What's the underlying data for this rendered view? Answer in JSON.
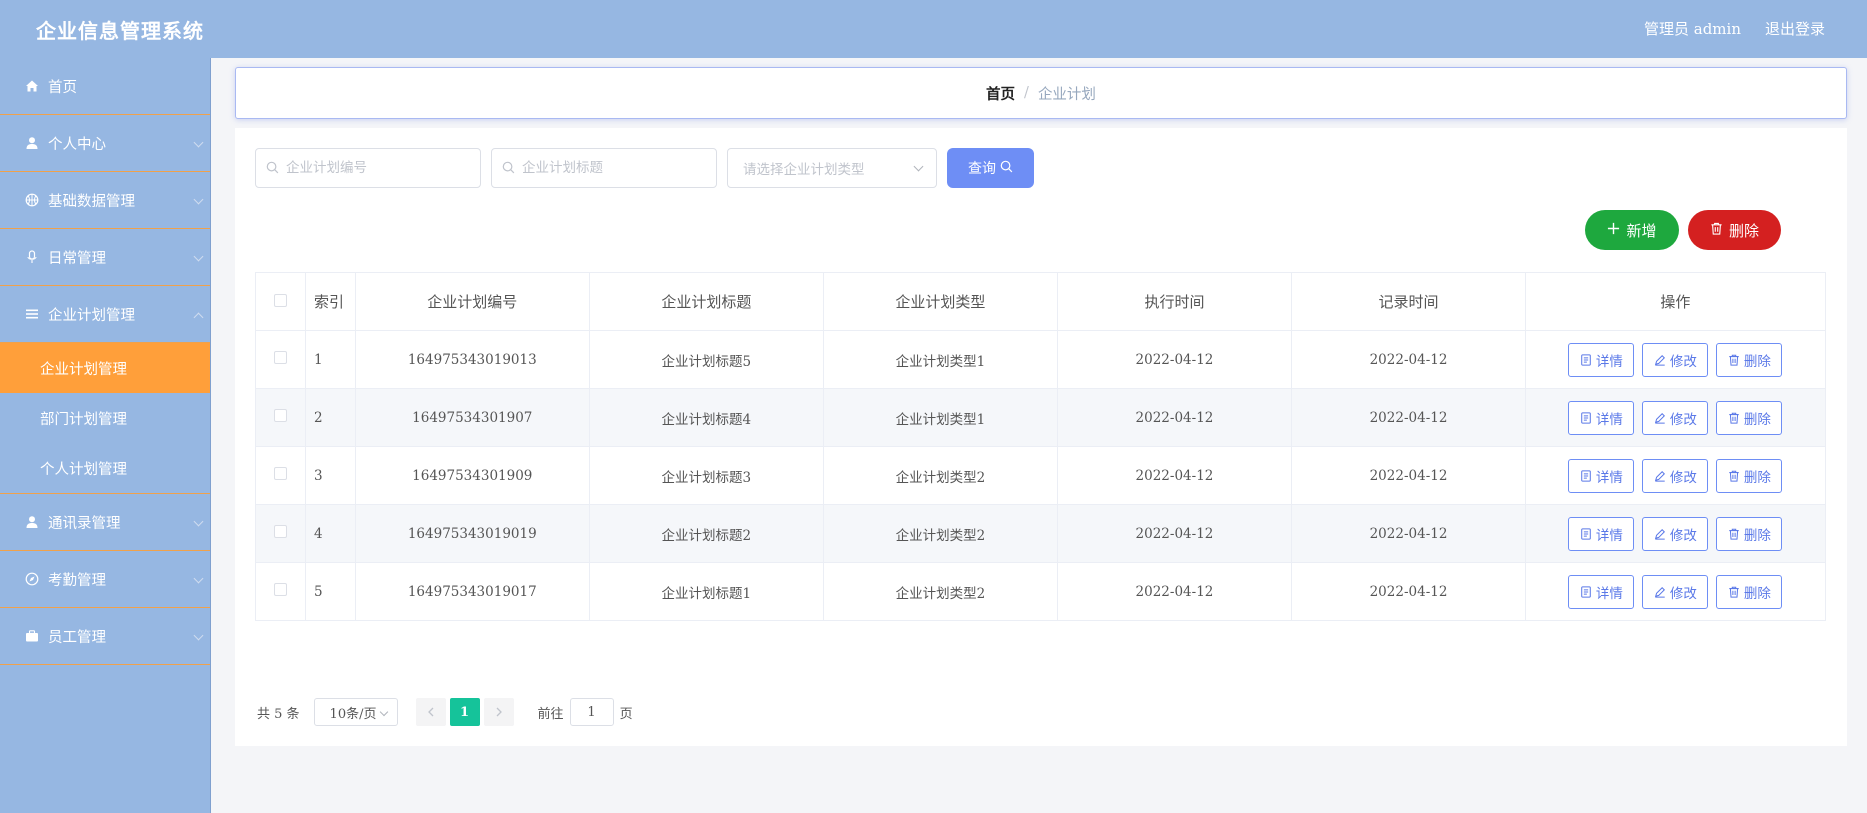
{
  "header": {
    "title": "企业信息管理系统",
    "user_label": "管理员 admin",
    "logout_label": "退出登录"
  },
  "sidebar": {
    "items": [
      {
        "label": "首页",
        "icon": "home-icon"
      },
      {
        "label": "个人中心",
        "icon": "user-icon"
      },
      {
        "label": "基础数据管理",
        "icon": "basketball-icon"
      },
      {
        "label": "日常管理",
        "icon": "microphone-icon"
      },
      {
        "label": "企业计划管理",
        "icon": "menu-icon",
        "children": [
          "企业计划管理",
          "部门计划管理",
          "个人计划管理"
        ],
        "active_child": "企业计划管理"
      },
      {
        "label": "通讯录管理",
        "icon": "user-icon"
      },
      {
        "label": "考勤管理",
        "icon": "compass-icon"
      },
      {
        "label": "员工管理",
        "icon": "briefcase-icon"
      }
    ]
  },
  "breadcrumb": {
    "home": "首页",
    "separator": "/",
    "current": "企业计划"
  },
  "search": {
    "code_placeholder": "企业计划编号",
    "title_placeholder": "企业计划标题",
    "type_placeholder": "请选择企业计划类型",
    "query_label": "查询"
  },
  "actions": {
    "add_label": "新增",
    "delete_label": "删除"
  },
  "table": {
    "headers": {
      "index": "索引",
      "code": "企业计划编号",
      "title": "企业计划标题",
      "type": "企业计划类型",
      "exec_time": "执行时间",
      "record_time": "记录时间",
      "ops": "操作"
    },
    "rows": [
      {
        "index": "1",
        "code": "164975343019013",
        "title": "企业计划标题5",
        "type": "企业计划类型1",
        "exec_time": "2022-04-12",
        "record_time": "2022-04-12"
      },
      {
        "index": "2",
        "code": "16497534301907",
        "title": "企业计划标题4",
        "type": "企业计划类型1",
        "exec_time": "2022-04-12",
        "record_time": "2022-04-12"
      },
      {
        "index": "3",
        "code": "16497534301909",
        "title": "企业计划标题3",
        "type": "企业计划类型2",
        "exec_time": "2022-04-12",
        "record_time": "2022-04-12"
      },
      {
        "index": "4",
        "code": "164975343019019",
        "title": "企业计划标题2",
        "type": "企业计划类型2",
        "exec_time": "2022-04-12",
        "record_time": "2022-04-12"
      },
      {
        "index": "5",
        "code": "164975343019017",
        "title": "企业计划标题1",
        "type": "企业计划类型2",
        "exec_time": "2022-04-12",
        "record_time": "2022-04-12"
      }
    ],
    "op_labels": {
      "detail": "详情",
      "edit": "修改",
      "delete": "删除"
    }
  },
  "pagination": {
    "total_label": "共 5 条",
    "page_size": "10条/页",
    "current_page": "1",
    "goto_label": "前往",
    "goto_value": "1",
    "page_unit": "页"
  },
  "colors": {
    "header_bg": "#96b7e2",
    "active_menu": "#ff9f3a",
    "query_btn": "#6e8ef5",
    "add_btn": "#1ea83e",
    "delete_btn": "#d42020",
    "page_active": "#15c39a"
  }
}
